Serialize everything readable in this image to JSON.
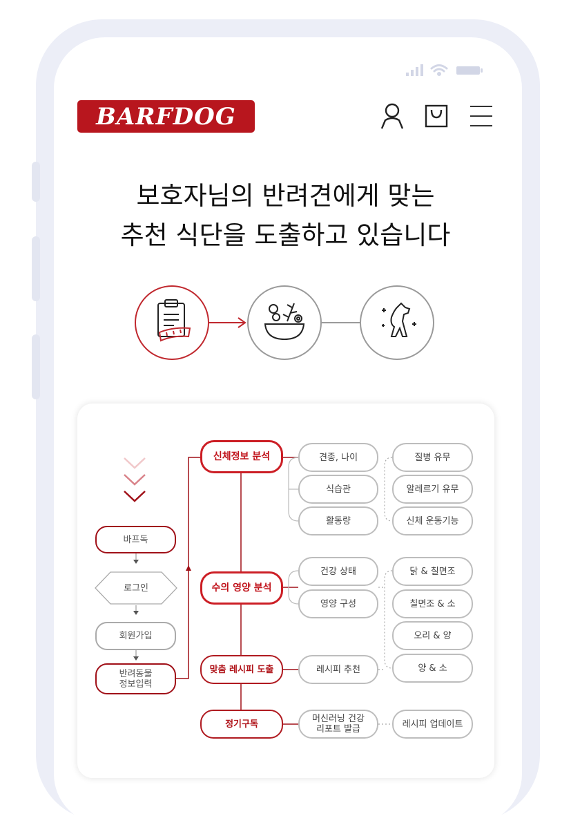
{
  "brand": {
    "logo_text": "BARFDOG",
    "accent": "#b8161e"
  },
  "status_bar": {
    "icons": [
      "signal-icon",
      "wifi-icon",
      "battery-icon"
    ]
  },
  "header": {
    "icons": [
      "user-icon",
      "cart-icon",
      "menu-icon"
    ]
  },
  "headline": {
    "line1": "보호자님의 반려견에게 맞는",
    "line2": "추천 식단을 도출하고 있습니다"
  },
  "process_icons": [
    "clipboard-icon",
    "food-bowl-icon",
    "dog-icon"
  ],
  "flow": {
    "left_steps": [
      "바프독",
      "로그인",
      "회원가입",
      "반려동물\n정보입력"
    ],
    "main_steps": [
      "신체정보 분석",
      "수의 영양 분석",
      "맞춤 레시피 도출",
      "정기구독"
    ],
    "body_info": [
      "견종, 나이",
      "식습관",
      "활동량"
    ],
    "body_checks": [
      "질병 유무",
      "알레르기 유무",
      "신체 운동기능"
    ],
    "nutrition": [
      "건강 상태",
      "영양 구성"
    ],
    "recipes": [
      "닭 & 칠면조",
      "칠면조 & 소",
      "오리 & 양",
      "양 & 소"
    ],
    "recipe_recommend": "레시피 추천",
    "report": "머신러닝 건강\n리포트 발급",
    "recipe_update": "레시피 업데이트"
  }
}
